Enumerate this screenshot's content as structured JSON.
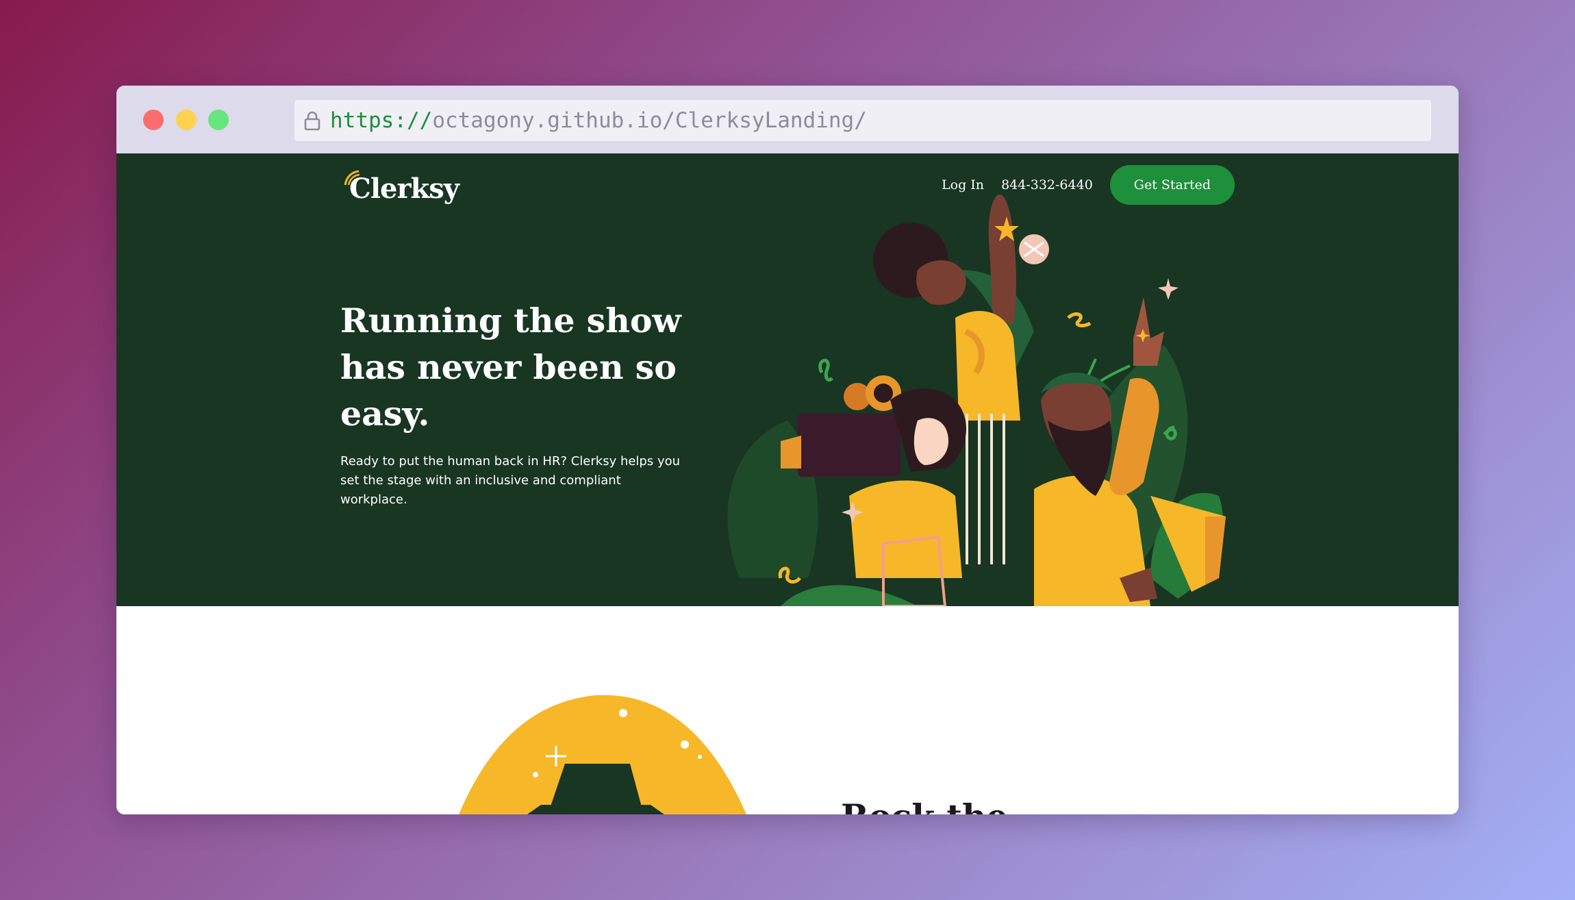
{
  "browser": {
    "url_scheme": "https://",
    "url_rest": "octagony.github.io/ClerksyLanding/",
    "icons": [
      "lock-icon"
    ]
  },
  "header": {
    "logo_text": "Clerksy",
    "nav": {
      "login_label": "Log In",
      "phone": "844-332-6440",
      "cta_label": "Get Started"
    }
  },
  "hero": {
    "headline": "Running the show has never been so easy.",
    "subtext": "Ready to put the human back in HR? Clerksy helps you set the stage with an inclusive and compliant workplace."
  },
  "section2": {
    "heading_partial": "Rock the"
  },
  "colors": {
    "hero_bg": "#183622",
    "cta_bg": "#1e8f3a",
    "accent_yellow": "#f6b828",
    "url_scheme": "#1e8e3e"
  }
}
